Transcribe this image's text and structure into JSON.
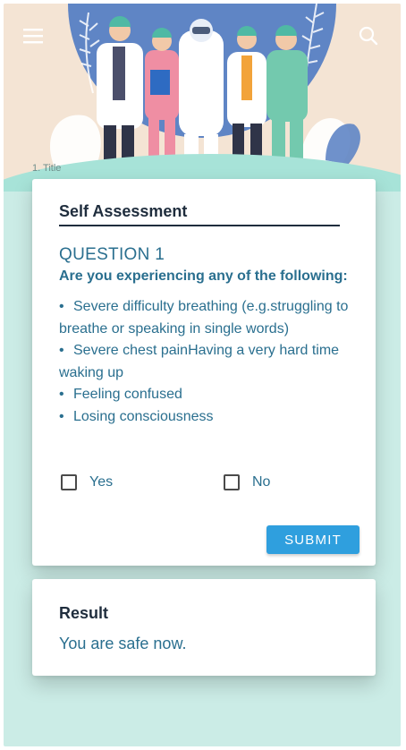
{
  "header": {
    "menu_icon": "hamburger-menu-icon",
    "search_icon": "search-icon",
    "step_label": "1. Title"
  },
  "assessment": {
    "title": "Self Assessment",
    "question_heading": "QUESTION 1",
    "question_text": "Are you experiencing any of the following:",
    "symptoms": [
      "Severe difficulty breathing (e.g.struggling to breathe or speaking in single words)",
      "Severe chest painHaving a very hard time waking up",
      "Feeling confused",
      "Losing consciousness"
    ],
    "bullet": "•",
    "options": {
      "yes": "Yes",
      "no": "No"
    },
    "submit_label": "SUBMIT"
  },
  "result": {
    "title": "Result",
    "text": "You are safe now."
  },
  "colors": {
    "accent": "#2f9fde",
    "text_teal": "#2a6f8f",
    "heading_dark": "#1f2d3d",
    "background_mint": "#cbece6"
  }
}
